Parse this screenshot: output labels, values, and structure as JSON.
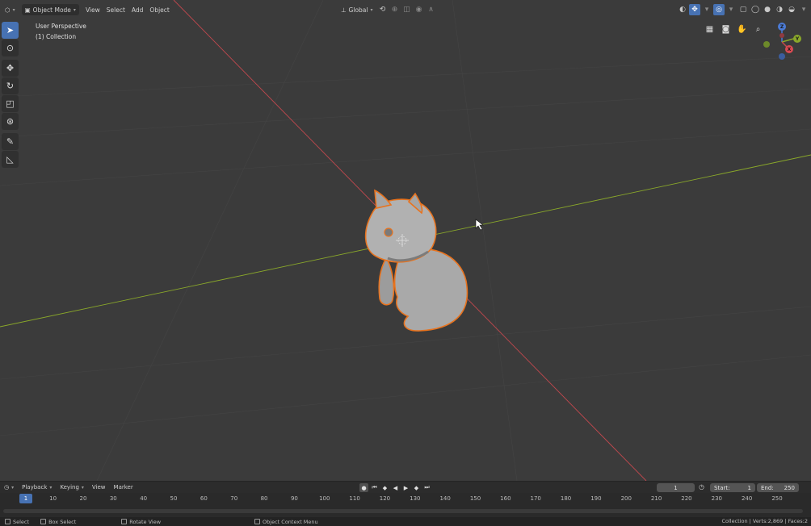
{
  "header": {
    "mode_label": "Object Mode",
    "menus": [
      "View",
      "Select",
      "Add",
      "Object"
    ],
    "transform_orientation": "Global"
  },
  "viewport": {
    "perspective_label": "User Perspective",
    "collection_label": "(1) Collection"
  },
  "gizmo": {
    "z_label": "Z",
    "y_label": "Y",
    "x_label": "X"
  },
  "timeline": {
    "menus": [
      "Playback",
      "Keying",
      "View",
      "Marker"
    ],
    "current_frame": "1",
    "start_label": "Start:",
    "start_value": "1",
    "end_label": "End:",
    "end_value": "250",
    "ruler_ticks": [
      "10",
      "20",
      "30",
      "40",
      "50",
      "60",
      "70",
      "80",
      "90",
      "100",
      "110",
      "120",
      "130",
      "140",
      "150",
      "160",
      "170",
      "180",
      "190",
      "200",
      "210",
      "220",
      "230",
      "240",
      "250"
    ]
  },
  "statusbar": {
    "select_label": "Select",
    "box_select_label": "Box Select",
    "rotate_view_label": "Rotate View",
    "context_menu_label": "Object Context Menu",
    "stats": "Collection | Verts:2,869 | Faces:2"
  },
  "colors": {
    "accent": "#4772b3",
    "selection_outline": "#e8731e",
    "x_axis": "#c2484e",
    "y_axis": "#8aa82a"
  },
  "icons": {
    "editor_type": "cube-icon",
    "toolbar": [
      "select-box-icon",
      "cursor-icon",
      "move-icon",
      "rotate-icon",
      "scale-icon",
      "transform-icon",
      "annotate-icon",
      "measure-icon"
    ],
    "navigation": [
      "grid-view-icon",
      "camera-icon",
      "hand-icon",
      "zoom-icon"
    ]
  }
}
